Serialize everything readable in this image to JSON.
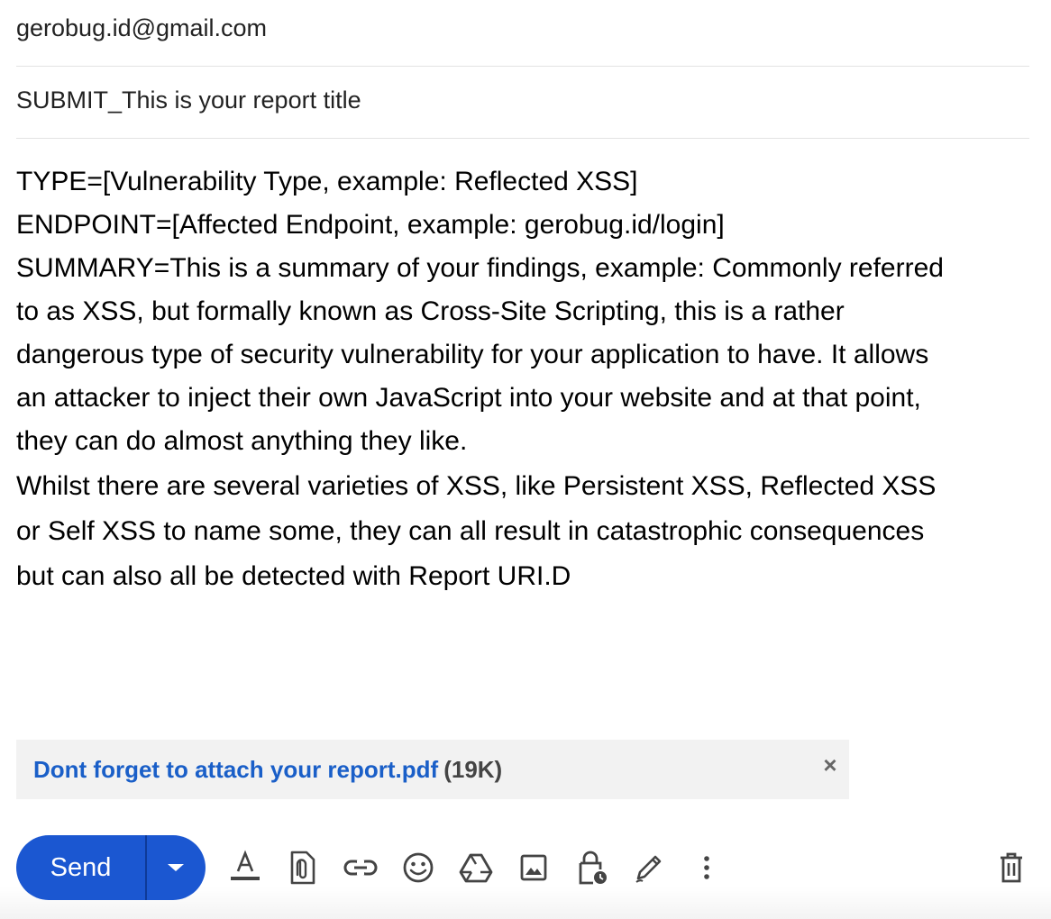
{
  "compose": {
    "to": "gerobug.id@gmail.com",
    "subject": "SUBMIT_This is your report title",
    "body_lines": [
      "TYPE=[Vulnerability Type, example: Reflected XSS]",
      "ENDPOINT=[Affected Endpoint, example: gerobug.id/login]",
      "SUMMARY=This is a summary of your findings, example: Commonly referred",
      "to as XSS, but formally known as Cross-Site Scripting, this is a rather",
      "dangerous type of security vulnerability for your application to have. It allows",
      "an attacker to inject their own JavaScript into your website and at that point,",
      "they can do almost anything they like.",
      "Whilst there are several varieties of XSS, like Persistent XSS, Reflected XSS",
      "or Self XSS to name some, they can all result in catastrophic consequences",
      "but can also all be detected with Report URI.D"
    ]
  },
  "attachment": {
    "name": "Dont forget to attach your report.pdf",
    "size": "(19K)",
    "close_glyph": "×"
  },
  "toolbar": {
    "send_label": "Send",
    "icons": [
      "text-format-icon",
      "attach-file-icon",
      "insert-link-icon",
      "emoji-icon",
      "google-drive-icon",
      "insert-photo-icon",
      "confidential-mode-icon",
      "signature-icon",
      "more-options-icon",
      "discard-draft-icon"
    ]
  },
  "colors": {
    "send_button": "#1b57d1",
    "attachment_link": "#1a5fc8",
    "attachment_bg": "#f2f2f2"
  }
}
